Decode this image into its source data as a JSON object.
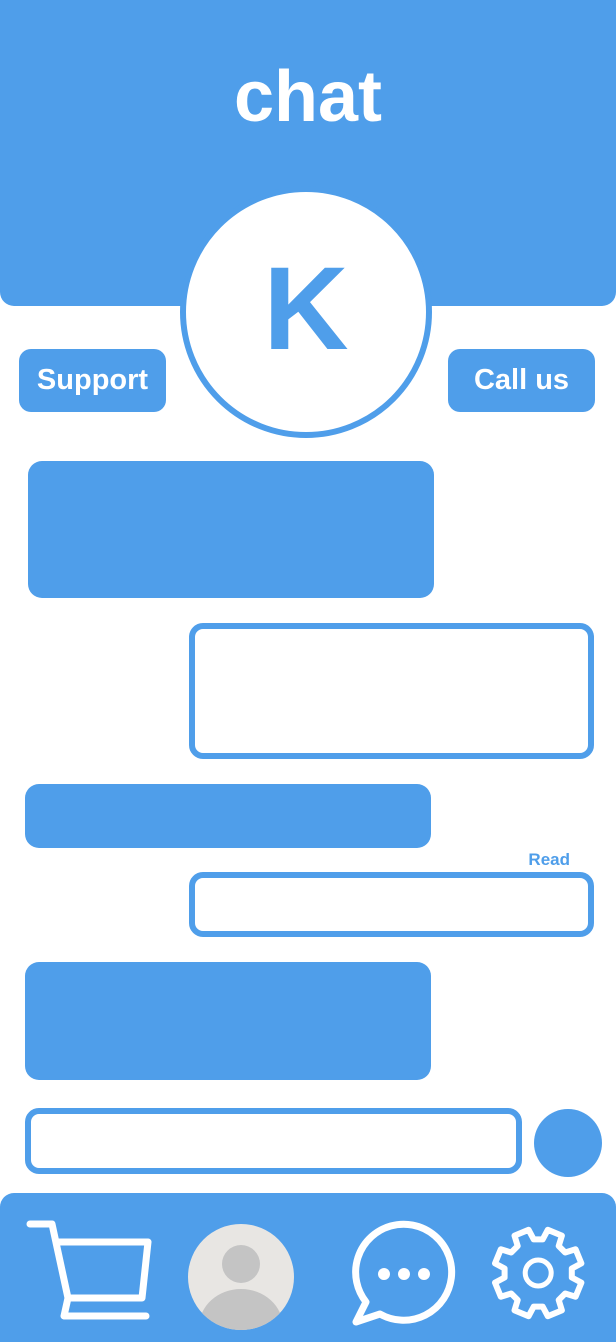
{
  "header": {
    "title": "chat",
    "avatar_letter": "K"
  },
  "actions": {
    "support_label": "Support",
    "call_label": "Call us"
  },
  "messages": [
    {
      "direction": "incoming",
      "text": ""
    },
    {
      "direction": "outgoing",
      "text": ""
    },
    {
      "direction": "incoming",
      "text": ""
    },
    {
      "direction": "outgoing",
      "text": "",
      "status": "Read"
    },
    {
      "direction": "incoming",
      "text": ""
    }
  ],
  "composer": {
    "value": "",
    "placeholder": ""
  },
  "bottom_nav": {
    "items": [
      {
        "icon": "cart-icon"
      },
      {
        "icon": "profile-avatar-icon"
      },
      {
        "icon": "chat-bubble-icon"
      },
      {
        "icon": "gear-icon"
      }
    ]
  },
  "colors": {
    "accent": "#4f9eea",
    "background": "#ffffff",
    "avatar_grey": "#c4c4c4"
  }
}
